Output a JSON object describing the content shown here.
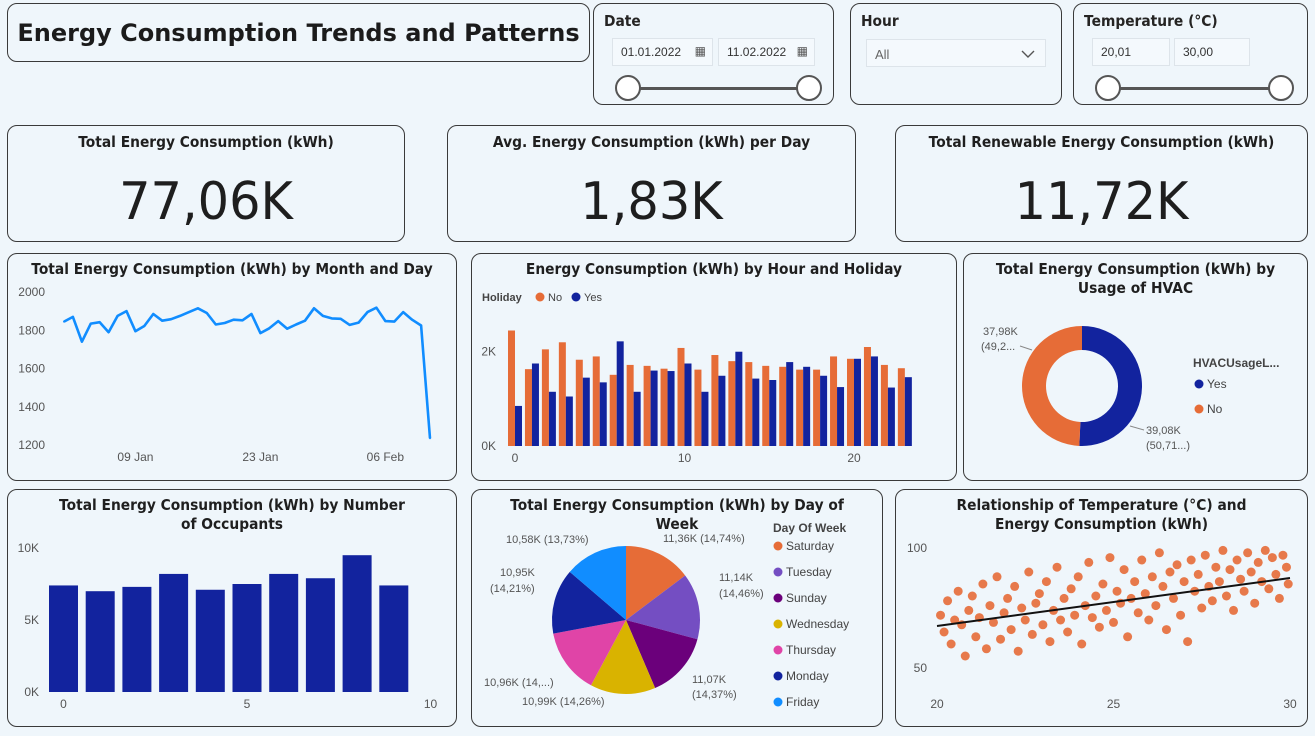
{
  "header": {
    "title": "Energy Consumption Trends and Patterns"
  },
  "filters": {
    "date": {
      "label": "Date",
      "from": "01.01.2022",
      "to": "11.02.2022"
    },
    "hour": {
      "label": "Hour",
      "value": "All"
    },
    "temperature": {
      "label": "Temperature (°C)",
      "from": "20,01",
      "to": "30,00"
    }
  },
  "kpis": [
    {
      "label": "Total Energy Consumption (kWh)",
      "value": "77,06K"
    },
    {
      "label": "Avg. Energy Consumption (kWh) per Day",
      "value": "1,83K"
    },
    {
      "label": "Total Renewable Energy Consumption (kWh)",
      "value": "11,72K"
    }
  ],
  "colors": {
    "accent_line": "#118dff",
    "no": "#e66c37",
    "yes": "#12239e",
    "bar": "#12239e"
  },
  "chart_data": [
    {
      "type": "line",
      "title": "Total Energy Consumption (kWh) by Month and Day",
      "x": [
        "2022-01-01",
        "2022-01-02",
        "2022-01-03",
        "2022-01-04",
        "2022-01-05",
        "2022-01-06",
        "2022-01-07",
        "2022-01-08",
        "2022-01-09",
        "2022-01-10",
        "2022-01-11",
        "2022-01-12",
        "2022-01-13",
        "2022-01-14",
        "2022-01-15",
        "2022-01-16",
        "2022-01-17",
        "2022-01-18",
        "2022-01-19",
        "2022-01-20",
        "2022-01-21",
        "2022-01-22",
        "2022-01-23",
        "2022-01-24",
        "2022-01-25",
        "2022-01-26",
        "2022-01-27",
        "2022-01-28",
        "2022-01-29",
        "2022-01-30",
        "2022-01-31",
        "2022-02-01",
        "2022-02-02",
        "2022-02-03",
        "2022-02-04",
        "2022-02-05",
        "2022-02-06",
        "2022-02-07",
        "2022-02-08",
        "2022-02-09",
        "2022-02-10",
        "2022-02-11"
      ],
      "values": [
        1845,
        1870,
        1740,
        1835,
        1842,
        1790,
        1875,
        1900,
        1795,
        1822,
        1885,
        1850,
        1858,
        1875,
        1895,
        1915,
        1890,
        1830,
        1838,
        1855,
        1852,
        1885,
        1785,
        1810,
        1848,
        1808,
        1830,
        1850,
        1915,
        1875,
        1862,
        1860,
        1828,
        1840,
        1895,
        1918,
        1848,
        1845,
        1895,
        1855,
        1825,
        1235
      ],
      "x_ticks": [
        "09 Jan",
        "23 Jan",
        "06 Feb"
      ],
      "y_ticks": [
        "2000",
        "1800",
        "1600",
        "1400",
        "1200"
      ],
      "ylim": [
        1200,
        2000
      ]
    },
    {
      "type": "bar",
      "title": "Energy Consumption (kWh) by Hour and Holiday",
      "legend_title": "Holiday",
      "categories": [
        0,
        1,
        2,
        3,
        4,
        5,
        6,
        7,
        8,
        9,
        10,
        11,
        12,
        13,
        14,
        15,
        16,
        17,
        18,
        19,
        20,
        21,
        22,
        23
      ],
      "series": [
        {
          "name": "No",
          "values": [
            2450,
            1630,
            2050,
            2200,
            1830,
            1900,
            1510,
            1720,
            1700,
            1640,
            2080,
            1620,
            1930,
            1800,
            1780,
            1700,
            1680,
            1620,
            1620,
            1900,
            1850,
            2100,
            1720,
            1650
          ]
        },
        {
          "name": "Yes",
          "values": [
            850,
            1750,
            1150,
            1050,
            1450,
            1350,
            2220,
            1150,
            1600,
            1590,
            1750,
            1150,
            1490,
            2000,
            1430,
            1400,
            1780,
            1680,
            1490,
            1250,
            1850,
            1900,
            1240,
            1460
          ]
        }
      ],
      "x_ticks": [
        "0",
        "10",
        "20"
      ],
      "y_ticks": [
        "2K",
        "0K"
      ],
      "ylim": [
        0,
        2800
      ]
    },
    {
      "type": "pie",
      "title": "Total Energy Consumption (kWh) by Usage of HVAC",
      "legend_title": "HVACUsageL...",
      "slices": [
        {
          "name": "Yes",
          "value": 39.08,
          "label": "39,08K",
          "pct": "(50,71...)"
        },
        {
          "name": "No",
          "value": 37.98,
          "label": "37,98K",
          "pct": "(49,2..."
        }
      ]
    },
    {
      "type": "bar",
      "title": "Total Energy Consumption (kWh) by Number of Occupants",
      "categories": [
        0,
        1,
        2,
        3,
        4,
        5,
        6,
        7,
        8,
        9
      ],
      "values": [
        7400,
        7000,
        7300,
        8200,
        7100,
        7500,
        8200,
        7900,
        9500,
        7400
      ],
      "x_ticks": [
        "0",
        "5",
        "10"
      ],
      "y_ticks": [
        "10K",
        "5K",
        "0K"
      ],
      "ylim": [
        0,
        10000
      ]
    },
    {
      "type": "pie",
      "title": "Total Energy Consumption (kWh) by Day of Week",
      "legend_title": "Day Of Week",
      "slices": [
        {
          "name": "Saturday",
          "value": 11.36,
          "label": "11,36K (14,74%)"
        },
        {
          "name": "Tuesday",
          "value": 11.14,
          "label": "11,14K",
          "label2": "(14,46%)"
        },
        {
          "name": "Sunday",
          "value": 11.07,
          "label": "11,07K",
          "label2": "(14,37%)"
        },
        {
          "name": "Wednesday",
          "value": 10.99,
          "label": "10,99K (14,26%)"
        },
        {
          "name": "Thursday",
          "value": 10.96,
          "label": "10,96K (14,...)"
        },
        {
          "name": "Monday",
          "value": 10.95,
          "label": "10,95K",
          "label2": "(14,21%)"
        },
        {
          "name": "Friday",
          "value": 10.58,
          "label": "10,58K (13,73%)"
        }
      ]
    },
    {
      "type": "scatter",
      "title": "Relationship of Temperature (°C) and Energy Consumption (kWh)",
      "x_ticks": [
        "20",
        "25",
        "30"
      ],
      "y_ticks": [
        "100",
        "50"
      ],
      "xlim": [
        20,
        30
      ],
      "ylim": [
        50,
        100
      ],
      "trend": {
        "x": [
          20,
          30
        ],
        "y": [
          67.5,
          87.5
        ]
      },
      "points": [
        [
          20.1,
          72
        ],
        [
          20.2,
          65
        ],
        [
          20.3,
          78
        ],
        [
          20.4,
          60
        ],
        [
          20.5,
          70
        ],
        [
          20.6,
          82
        ],
        [
          20.7,
          68
        ],
        [
          20.8,
          55
        ],
        [
          20.9,
          74
        ],
        [
          21.0,
          80
        ],
        [
          21.1,
          63
        ],
        [
          21.2,
          71
        ],
        [
          21.3,
          85
        ],
        [
          21.4,
          58
        ],
        [
          21.5,
          76
        ],
        [
          21.6,
          69
        ],
        [
          21.7,
          88
        ],
        [
          21.8,
          62
        ],
        [
          21.9,
          73
        ],
        [
          22.0,
          79
        ],
        [
          22.1,
          66
        ],
        [
          22.2,
          84
        ],
        [
          22.3,
          57
        ],
        [
          22.4,
          75
        ],
        [
          22.5,
          70
        ],
        [
          22.6,
          90
        ],
        [
          22.7,
          64
        ],
        [
          22.8,
          77
        ],
        [
          22.9,
          81
        ],
        [
          23.0,
          68
        ],
        [
          23.1,
          86
        ],
        [
          23.2,
          61
        ],
        [
          23.3,
          74
        ],
        [
          23.4,
          92
        ],
        [
          23.5,
          70
        ],
        [
          23.6,
          79
        ],
        [
          23.7,
          65
        ],
        [
          23.8,
          83
        ],
        [
          23.9,
          72
        ],
        [
          24.0,
          88
        ],
        [
          24.1,
          60
        ],
        [
          24.2,
          76
        ],
        [
          24.3,
          94
        ],
        [
          24.4,
          71
        ],
        [
          24.5,
          80
        ],
        [
          24.6,
          67
        ],
        [
          24.7,
          85
        ],
        [
          24.8,
          74
        ],
        [
          24.9,
          96
        ],
        [
          25.0,
          69
        ],
        [
          25.1,
          82
        ],
        [
          25.2,
          77
        ],
        [
          25.3,
          91
        ],
        [
          25.4,
          63
        ],
        [
          25.5,
          79
        ],
        [
          25.6,
          86
        ],
        [
          25.7,
          73
        ],
        [
          25.8,
          95
        ],
        [
          25.9,
          81
        ],
        [
          26.0,
          70
        ],
        [
          26.1,
          88
        ],
        [
          26.2,
          76
        ],
        [
          26.3,
          98
        ],
        [
          26.4,
          84
        ],
        [
          26.5,
          66
        ],
        [
          26.6,
          90
        ],
        [
          26.7,
          79
        ],
        [
          26.8,
          93
        ],
        [
          26.9,
          72
        ],
        [
          27.0,
          86
        ],
        [
          27.1,
          61
        ],
        [
          27.2,
          95
        ],
        [
          27.3,
          82
        ],
        [
          27.4,
          89
        ],
        [
          27.5,
          75
        ],
        [
          27.6,
          97
        ],
        [
          27.7,
          84
        ],
        [
          27.8,
          78
        ],
        [
          27.9,
          92
        ],
        [
          28.0,
          86
        ],
        [
          28.1,
          99
        ],
        [
          28.2,
          80
        ],
        [
          28.3,
          91
        ],
        [
          28.4,
          74
        ],
        [
          28.5,
          95
        ],
        [
          28.6,
          87
        ],
        [
          28.7,
          82
        ],
        [
          28.8,
          98
        ],
        [
          28.9,
          90
        ],
        [
          29.0,
          77
        ],
        [
          29.1,
          94
        ],
        [
          29.2,
          86
        ],
        [
          29.3,
          99
        ],
        [
          29.4,
          83
        ],
        [
          29.5,
          96
        ],
        [
          29.6,
          89
        ],
        [
          29.7,
          79
        ],
        [
          29.8,
          97
        ],
        [
          29.9,
          92
        ],
        [
          29.95,
          85
        ]
      ]
    }
  ]
}
